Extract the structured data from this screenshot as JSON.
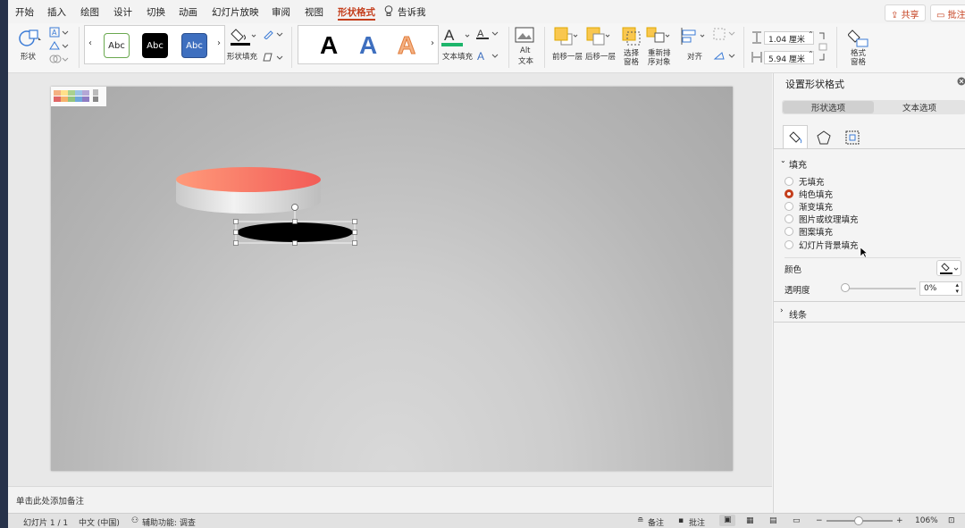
{
  "menu": {
    "tabs": [
      "开始",
      "插入",
      "绘图",
      "设计",
      "切换",
      "动画",
      "幻灯片放映",
      "审阅",
      "视图",
      "形状格式"
    ],
    "active_tab": "形状格式",
    "tell_me": "告诉我",
    "share": "共享",
    "comments": "批注"
  },
  "ribbon": {
    "shape_label": "形状",
    "abc_1": "Abc",
    "abc_2": "Abc",
    "abc_3": "Abc",
    "shape_fill_label": "形状填充",
    "text_fill_label": "文本填充",
    "wordart_letter": "A",
    "alt_text_label_1": "Alt",
    "alt_text_label_2": "文本",
    "bring_forward": "前移一层",
    "send_backward": "后移一层",
    "select_pane_1": "选择",
    "select_pane_2": "窗格",
    "reorder_1": "重新排",
    "reorder_2": "序对象",
    "align": "对齐",
    "height_value": "1.04 厘米",
    "width_value": "5.94 厘米",
    "format_pane_1": "格式",
    "format_pane_2": "窗格"
  },
  "pane": {
    "title": "设置形状格式",
    "tab_shape": "形状选项",
    "tab_text": "文本选项",
    "fill_header": "填充",
    "fill_options": [
      "无填充",
      "纯色填充",
      "渐变填充",
      "图片或纹理填充",
      "图案填充",
      "幻灯片背景填充"
    ],
    "selected_fill": "纯色填充",
    "color_label": "颜色",
    "transparency_label": "透明度",
    "transparency_value": "0%",
    "line_header": "线条"
  },
  "notes_placeholder": "单击此处添加备注",
  "status": {
    "slide": "幻灯片 1 / 1",
    "language": "中文 (中国)",
    "accessibility": "辅助功能: 调查",
    "notes_btn": "备注",
    "comments_btn": "批注",
    "zoom": "106%"
  },
  "colors": {
    "accent": "#c43e1c",
    "cylinder_top_start": "#ff9a7a",
    "cylinder_top_end": "#f25c57",
    "selected_shape_fill": "#000000",
    "text_fill_bar": "#1db56b"
  }
}
